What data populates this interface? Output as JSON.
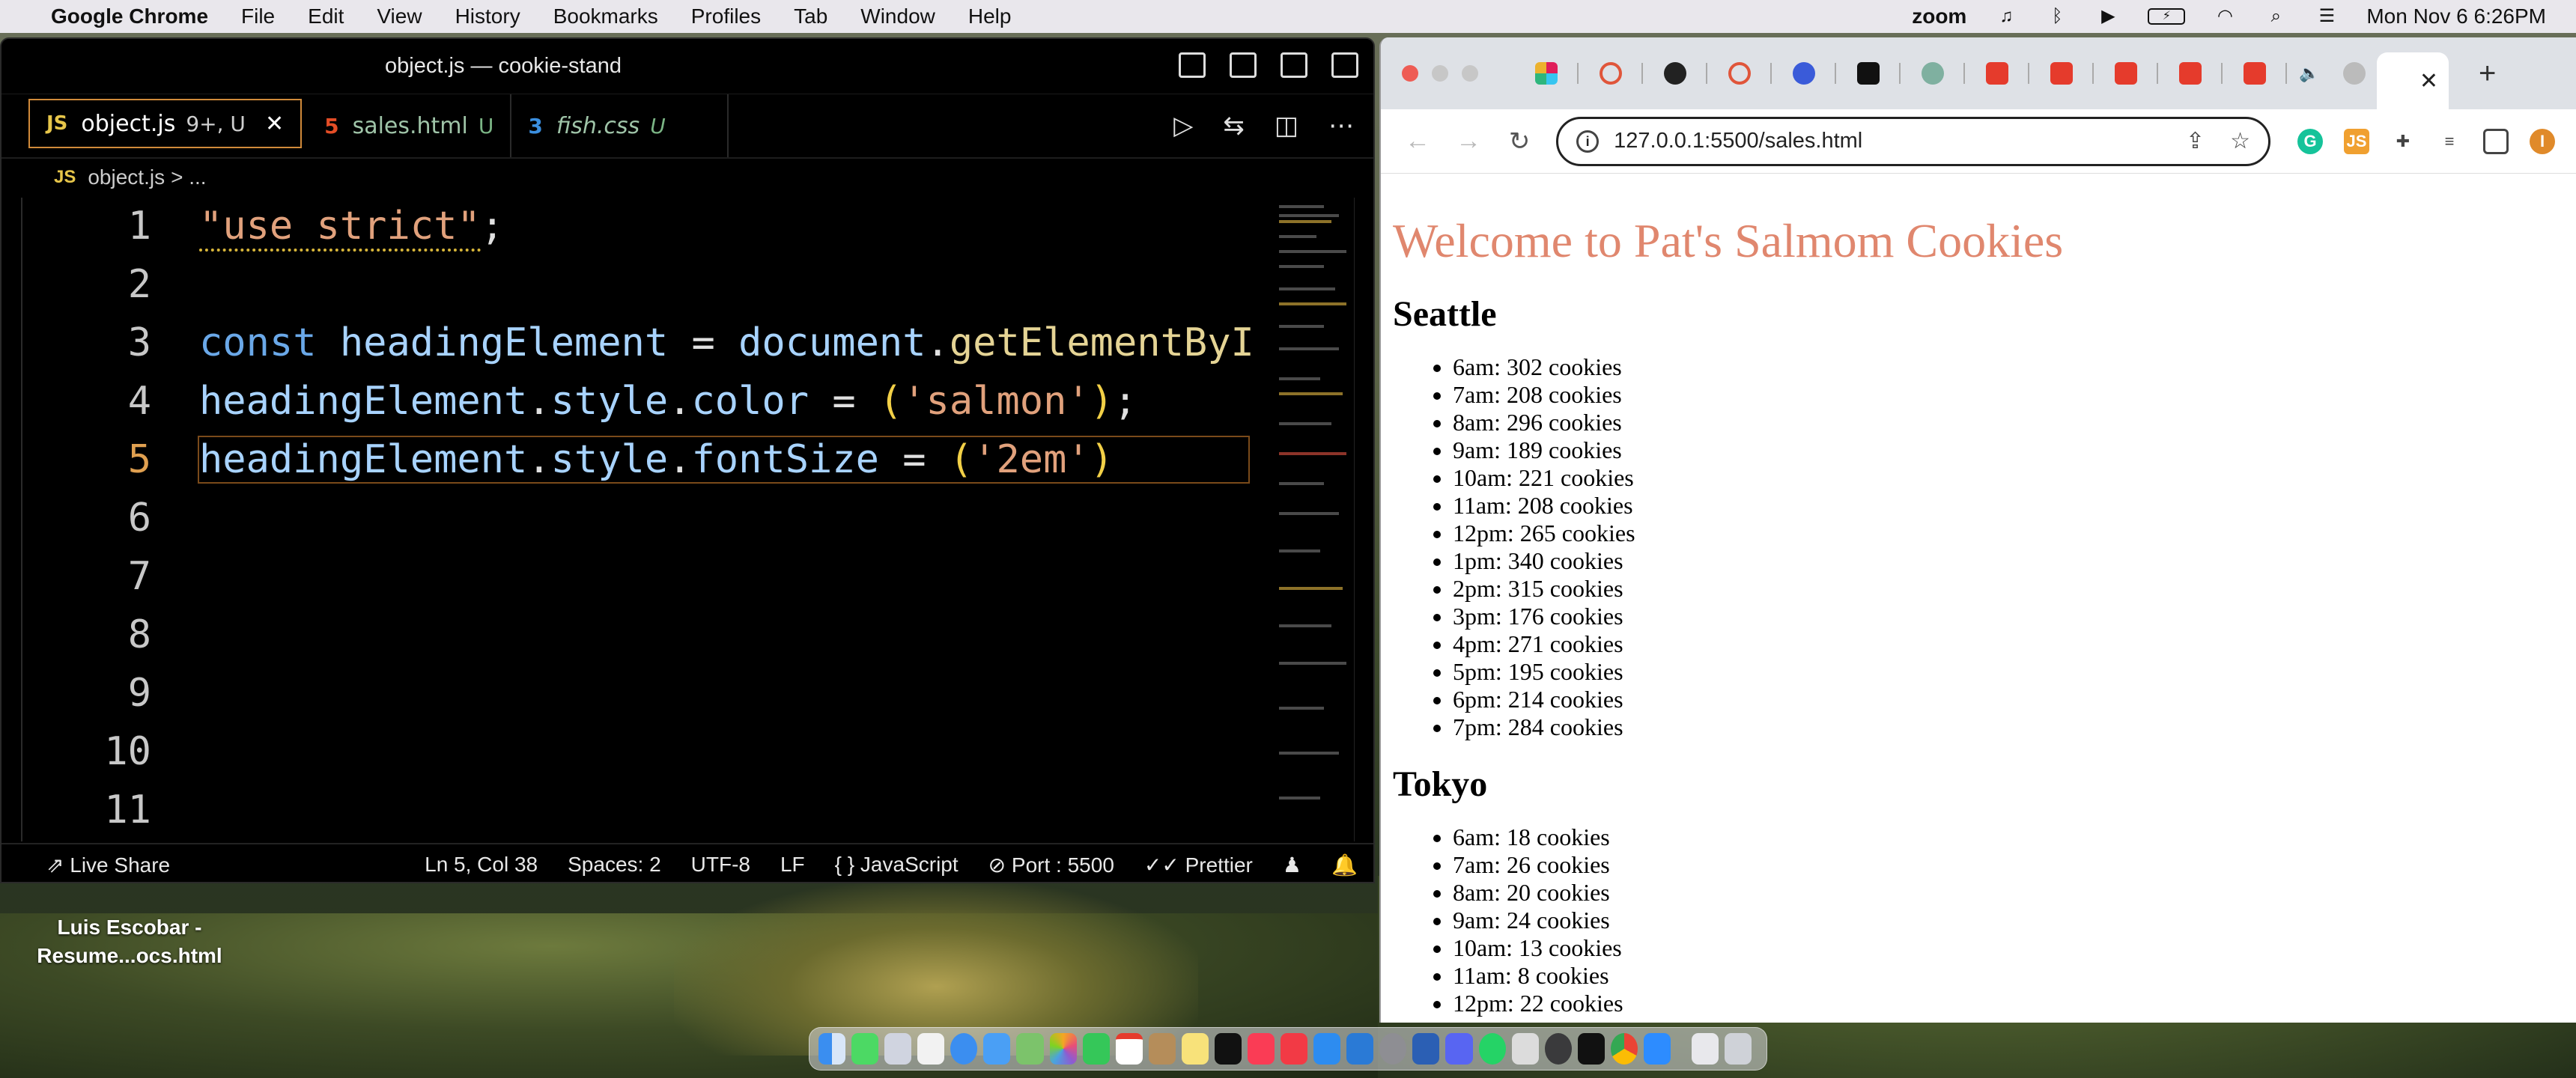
{
  "menubar": {
    "app": "Google Chrome",
    "items": [
      "File",
      "Edit",
      "View",
      "History",
      "Bookmarks",
      "Profiles",
      "Tab",
      "Window",
      "Help"
    ],
    "zoom": "zoom",
    "datetime": "Mon Nov 6  6:26PM"
  },
  "vscode": {
    "title": "object.js — cookie-stand",
    "tabs": [
      {
        "badge": "JS",
        "label": "object.js",
        "status": "9+, U"
      },
      {
        "badge": "5",
        "label": "sales.html",
        "status": "U"
      },
      {
        "badge": "3",
        "label": "fish.css",
        "status": "U"
      }
    ],
    "breadcrumb": {
      "file": "object.js",
      "rest": "> ..."
    },
    "lines": [
      "1",
      "2",
      "3",
      "4",
      "5",
      "6",
      "7",
      "8",
      "9",
      "10",
      "11"
    ],
    "code": {
      "l1_str": "\"use strict\"",
      "l1_end": ";",
      "l3_kw": "const",
      "l3_var": " headingElement ",
      "l3_op": "= ",
      "l3_obj": "document",
      "l3_dot": ".",
      "l3_fn": "getElementByI",
      "l4_var": "headingElement",
      "l4_dot1": ".",
      "l4_prop1": "style",
      "l4_dot2": ".",
      "l4_prop2": "color",
      "l4_op": " = ",
      "l4_open": "(",
      "l4_str": "'salmon'",
      "l4_close": ")",
      "l4_end": ";",
      "l5_var": "headingElement",
      "l5_dot1": ".",
      "l5_prop1": "style",
      "l5_dot2": ".",
      "l5_prop2": "fontSize",
      "l5_op": " = ",
      "l5_open": "(",
      "l5_str": "'2em'",
      "l5_close": ")"
    },
    "status": {
      "live_share": "Live Share",
      "position": "Ln 5, Col 38",
      "spaces": "Spaces: 2",
      "encoding": "UTF-8",
      "eol": "LF",
      "language": "{ }  JavaScript",
      "port": "Port : 5500",
      "prettier": "Prettier"
    }
  },
  "desktop": {
    "file_label_line1": "Luis Escobar -",
    "file_label_line2": "Resume...ocs.html"
  },
  "chrome": {
    "url": "127.0.0.1:5500/sales.html",
    "active_tab_close": "✕",
    "page": {
      "heading": "Welcome to Pat's Salmom Cookies",
      "cities": [
        {
          "name": "Seattle",
          "hours": [
            "6am: 302 cookies",
            "7am: 208 cookies",
            "8am: 296 cookies",
            "9am: 189 cookies",
            "10am: 221 cookies",
            "11am: 208 cookies",
            "12pm: 265 cookies",
            "1pm: 340 cookies",
            "2pm: 315 cookies",
            "3pm: 176 cookies",
            "4pm: 271 cookies",
            "5pm: 195 cookies",
            "6pm: 214 cookies",
            "7pm: 284 cookies"
          ]
        },
        {
          "name": "Tokyo",
          "hours": [
            "6am: 18 cookies",
            "7am: 26 cookies",
            "8am: 20 cookies",
            "9am: 24 cookies",
            "10am: 13 cookies",
            "11am: 8 cookies",
            "12pm: 22 cookies"
          ]
        }
      ]
    }
  },
  "colors": {
    "heading_salmon": "#e0876e",
    "vscode_bg": "#000000",
    "tab_active_border": "#d08a3a"
  }
}
